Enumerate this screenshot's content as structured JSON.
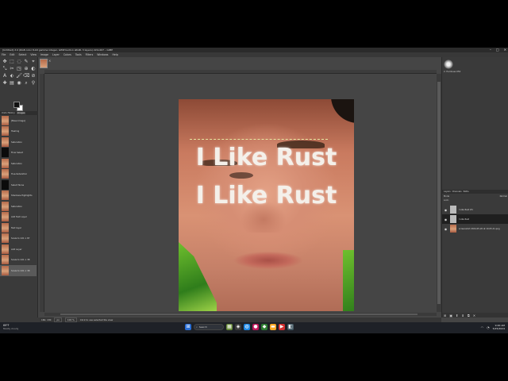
{
  "window": {
    "title": "[Untitled]-3.0 (RGB color 8-bit gamma integer, GIMP built-in sRGB, 3 layers) 221x267 – GIMP",
    "controls": [
      "–",
      "□",
      "✕"
    ]
  },
  "menu": [
    "File",
    "Edit",
    "Select",
    "View",
    "Image",
    "Layer",
    "Colors",
    "Tools",
    "Filters",
    "Windows",
    "Help"
  ],
  "tools": [
    "✥",
    "⬚",
    "◌",
    "✎",
    "⌖",
    "⤡",
    "✂",
    "◳",
    "⊕",
    "◐",
    "A",
    "⬖",
    "🖌",
    "⌫",
    "⊘",
    "✚",
    "▤",
    "◉",
    "⌕",
    "⚲"
  ],
  "history": {
    "tabs": [
      "Undo History",
      "Images"
    ],
    "items": [
      {
        "label": "[Base Image]",
        "thumb": "img"
      },
      {
        "label": "Healing",
        "thumb": "img"
      },
      {
        "label": "Saturation",
        "thumb": "img"
      },
      {
        "label": "Flow Select",
        "thumb": "dark"
      },
      {
        "label": "Saturation",
        "thumb": "img"
      },
      {
        "label": "Hue-Saturation",
        "thumb": "img"
      },
      {
        "label": "Select None",
        "thumb": "dark"
      },
      {
        "label": "Shadows-Highlights",
        "thumb": "img"
      },
      {
        "label": "Saturation",
        "thumb": "img"
      },
      {
        "label": "Add Text Layer",
        "thumb": "img"
      },
      {
        "label": "Text layer",
        "thumb": "img"
      },
      {
        "label": "Scale to 221 x 87",
        "thumb": "img"
      },
      {
        "label": "Add Layer",
        "thumb": "img"
      },
      {
        "label": "Scale to 221 x 38",
        "thumb": "img"
      },
      {
        "label": "Scale to 221 x 38",
        "thumb": "img"
      }
    ]
  },
  "canvas": {
    "line1": "I Like Rust",
    "line2": "I Like Rust"
  },
  "statusbar": {
    "coords": "160, 130",
    "unit": "px",
    "zoom": "100 %",
    "message": "Click to use selected tile view"
  },
  "rightdock": {
    "brush_label": "2. Hardness 050",
    "tabs": [
      "Layers",
      "Channels",
      "Paths"
    ],
    "mode_label": "Mode",
    "mode_value": "Normal",
    "lock_label": "Lock:",
    "layers": [
      {
        "label": "I Like Rust #1",
        "thumb": "txt",
        "selected": false
      },
      {
        "label": "I Like Rust",
        "thumb": "txt",
        "selected": true
      },
      {
        "label": "screenshot 2024-05-20 at 10.05.41.png",
        "thumb": "img",
        "selected": false
      }
    ],
    "bottom_icons": [
      "⊞",
      "▣",
      "⬆",
      "⬇",
      "⧉",
      "✕"
    ]
  },
  "taskbar": {
    "weather_temp": "69°F",
    "weather_desc": "Mostly cloudy",
    "search_label": "Search",
    "time": "9:00 AM",
    "date": "5/25/2024"
  }
}
